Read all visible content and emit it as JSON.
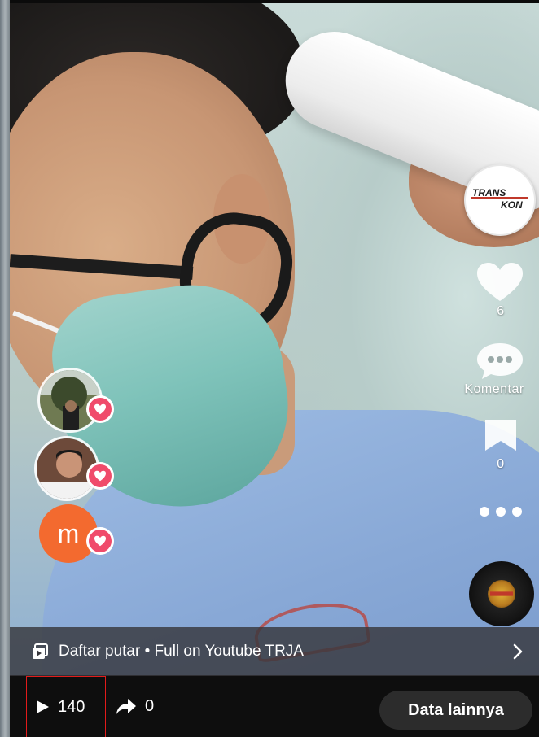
{
  "actions": {
    "likes_count": "6",
    "comment_label": "Komentar",
    "bookmark_count": "0",
    "brand_logo_text": "TRANS KON",
    "music_logo_text": "TRJA"
  },
  "likers": [
    {
      "type": "photo",
      "icon": "avatar-photo-1"
    },
    {
      "type": "photo",
      "icon": "avatar-photo-2"
    },
    {
      "type": "letter",
      "letter": "m"
    }
  ],
  "playlist": {
    "label": "Daftar putar • Full on Youtube TRJA"
  },
  "stats": {
    "plays": "140",
    "shares": "0"
  },
  "buttons": {
    "more_data": "Data lainnya"
  },
  "colors": {
    "like_heart": "#f04b6b",
    "letter_avatar": "#f36a2f",
    "highlight_box": "#e21b1b"
  }
}
